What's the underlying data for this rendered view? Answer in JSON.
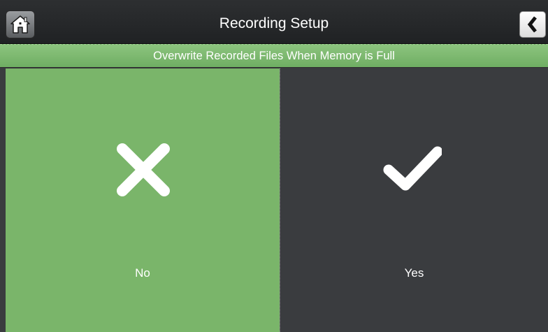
{
  "header": {
    "title": "Recording Setup",
    "home_icon": "home-icon",
    "back_icon": "chevron-left-icon"
  },
  "prompt": {
    "text": "Overwrite Recorded Files When Memory is Full"
  },
  "options": [
    {
      "label": "No",
      "icon": "close-icon",
      "selected": true
    },
    {
      "label": "Yes",
      "icon": "checkmark-icon",
      "selected": false
    }
  ],
  "colors": {
    "accent_green": "#7ab56a",
    "panel_dark": "#3a3c3f",
    "titlebar": "#232527",
    "text": "#ffffff"
  }
}
